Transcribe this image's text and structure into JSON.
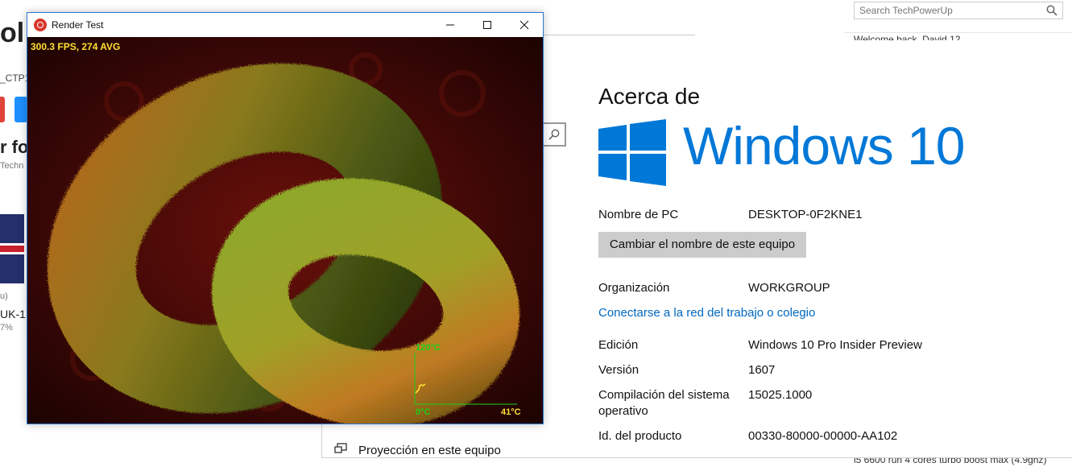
{
  "background_page": {
    "left_fragments": {
      "title_frag": "ol",
      "code_frag": "_CTP1",
      "heading_frag": "r fo",
      "source_frag": "Techn",
      "paren_frag": "u)",
      "uk_frag": "UK-1",
      "pct_frag": "7%"
    },
    "search_placeholder": "Search TechPowerUp",
    "search_icon": "search-icon",
    "welcome_frag": "Welcome back, David 12",
    "footer_text": "i5 6600 run 4 cores turbo boost max (4.9ghz)"
  },
  "render_test": {
    "title": "Render Test",
    "fps_text": "300.3 FPS, 274 AVG",
    "temp_max": "120°C",
    "temp_min": "0°C",
    "temp_current": "41°C",
    "colors": {
      "fps": "#ffe033",
      "graph": "#19d019",
      "border": "#2b79d0"
    }
  },
  "settings_about": {
    "heading": "Acerca de",
    "logo_text": "Windows 10",
    "pc_name_label": "Nombre de PC",
    "pc_name_value": "DESKTOP-0F2KNE1",
    "rename_button": "Cambiar el nombre de este equipo",
    "org_label": "Organización",
    "org_value": "WORKGROUP",
    "join_link": "Conectarse a la red del trabajo o colegio",
    "edition_label": "Edición",
    "edition_value": "Windows 10 Pro Insider Preview",
    "version_label": "Versión",
    "version_value": "1607",
    "build_label_line1": "Compilación del sistema",
    "build_label_line2": "operativo",
    "build_value": "15025.1000",
    "product_id_label": "Id. del producto",
    "product_id_value": "00330-80000-00000-AA102",
    "projection_item": "Proyección en este equipo",
    "colors": {
      "accent": "#0078d7",
      "link": "#0067c0",
      "button": "#cccccc"
    }
  }
}
